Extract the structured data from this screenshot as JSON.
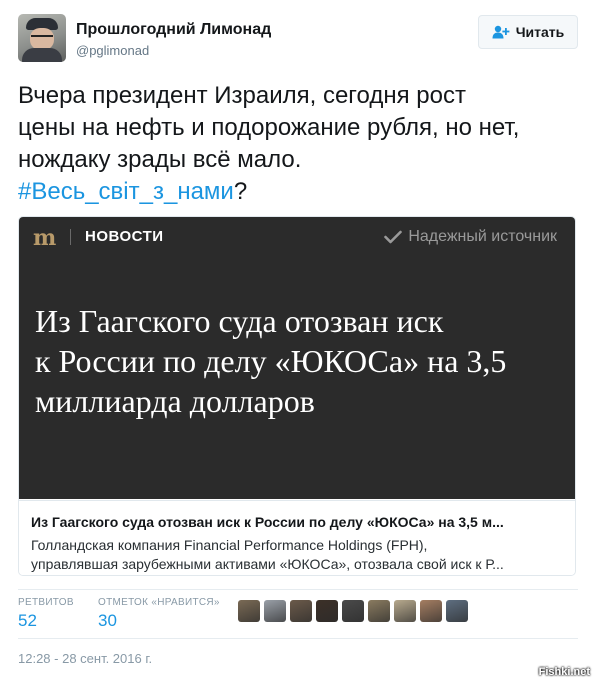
{
  "author": {
    "name": "Прошлогодний Лимонад",
    "handle": "@pglimonad"
  },
  "follow_button": {
    "label": "Читать",
    "icon": "person-add-icon"
  },
  "tweet": {
    "lines": [
      "Вчера президент Израиля, сегодня рост",
      "цены на нефть и подорожание рубля, но нет,",
      "нождаку зрады всё мало."
    ],
    "hashtag": "#Весь_світ_з_нами",
    "trailing": "?"
  },
  "card": {
    "logo": "m",
    "section": "НОВОСТИ",
    "trust_label": "Надежный источник",
    "headline_lines": [
      "Из Гаагского суда отозван иск",
      "к России по делу «ЮКОСа» на 3,5",
      "миллиарда долларов"
    ],
    "title": "Из Гаагского суда отозван иск к России по делу «ЮКОСа» на 3,5 м...",
    "description_lines": [
      "Голландская компания Financial Performance Holdings (FPH),",
      "управлявшая зарубежными активами «ЮКОСа», отозвала свой иск к Р..."
    ],
    "colors": {
      "background": "#2b2b2b",
      "logo": "#b89a6a"
    }
  },
  "stats": {
    "retweets_label": "РЕТВИТОВ",
    "retweets": "52",
    "likes_label": "ОТМЕТОК «НРАВИТСЯ»",
    "likes": "30"
  },
  "likers": [
    "#7a6a55",
    "#9aa0a8",
    "#6b5a4a",
    "#3c3028",
    "#4a4a4a",
    "#8a7b60",
    "#b8aa8e",
    "#a57e62",
    "#5e6e80"
  ],
  "timestamp": "12:28 - 28 сент. 2016 г.",
  "watermark": "Fishki.net",
  "accent": "#1b95e0"
}
